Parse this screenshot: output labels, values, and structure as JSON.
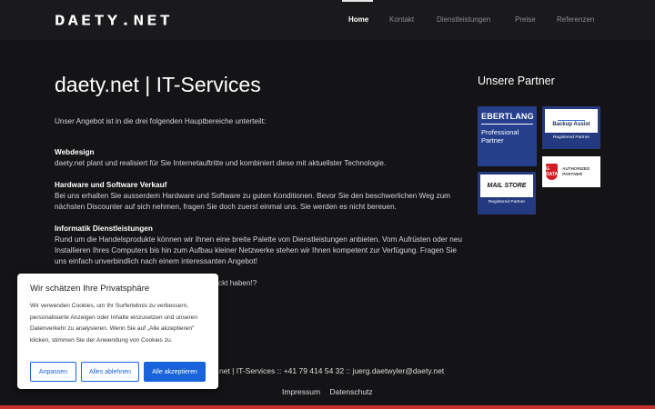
{
  "header": {
    "logo": "DAETY.NET",
    "nav": [
      {
        "label": "Home",
        "active": true
      },
      {
        "label": "Kontakt",
        "active": false
      },
      {
        "label": "Dienstleistungen",
        "active": false
      },
      {
        "label": "Preise",
        "active": false
      },
      {
        "label": "Referenzen",
        "active": false
      }
    ]
  },
  "main": {
    "title": "daety.net | IT-Services",
    "intro": "Unser Angebot ist in die drei folgenden Hauptbereiche unterteilt:",
    "sections": [
      {
        "heading": "Webdesign",
        "text": "daety.net plant und realisiert für Sie Internetauftritte und kombiniert diese mit aktuellster Technologie."
      },
      {
        "heading": "Hardware und Software Verkauf",
        "text": "Bei uns erhalten Sie ausserdem Hardware und Software zu guten Konditionen. Bevor Sie den beschwerlichen Weg zum nächsten Discounter auf sich nehmen, fragen Sie doch zuerst einmal uns. Sie werden es nicht bereuen."
      },
      {
        "heading": "Informatik Dienstleistungen",
        "text": "Rund um die Handelsprodukte können wir Ihnen eine breite Palette von Dienstleistungen anbieten. Vom Aufrüsten oder neu Installieren Ihres Computers bis hin zum Aufbau kleiner Netzwerke stehen wir Ihnen kompetent zur Verfügung. Fragen Sie uns einfach unverbindlich nach einem interessanten Angebot!"
      }
    ],
    "partial_line": "ckt haben!?"
  },
  "sidebar": {
    "title": "Unsere Partner",
    "eberlang": {
      "name": "EBERTLANG",
      "tagline": "Professional Partner"
    },
    "backup": {
      "name": "Backup Assist",
      "badge": "Registered Partner"
    },
    "gdata": {
      "logo": "G DATA",
      "text": "AUTHORIZED PARTNER"
    },
    "mailstore": {
      "name": "MAIL STORE",
      "badge": "Registered Partner"
    }
  },
  "footer": {
    "line": "net | IT-Services ::  +41 79 414 54 32 ::  juerg.daetwyler@daety.net",
    "links": [
      "Impressum",
      "Datenschutz"
    ]
  },
  "cookie": {
    "title": "Wir schätzen Ihre Privatsphäre",
    "text": "Wir verwenden Cookies, um Ihr Surferlebnis zu verbessern, personalisierte Anzeigen oder Inhalte einzusetzen und unseren Datenverkehr zu analysieren. Wenn Sie auf „Alle akzeptieren\" klicken, stimmen Sie der Anwendung von Cookies zu.",
    "buttons": {
      "customize": "Anpassen",
      "reject": "Alles ablehnen",
      "accept": "Alle akzeptieren"
    }
  },
  "colors": {
    "accent": "#1863dc",
    "partner_blue": "#263f8c",
    "bottom_bar": "#c9302c"
  }
}
